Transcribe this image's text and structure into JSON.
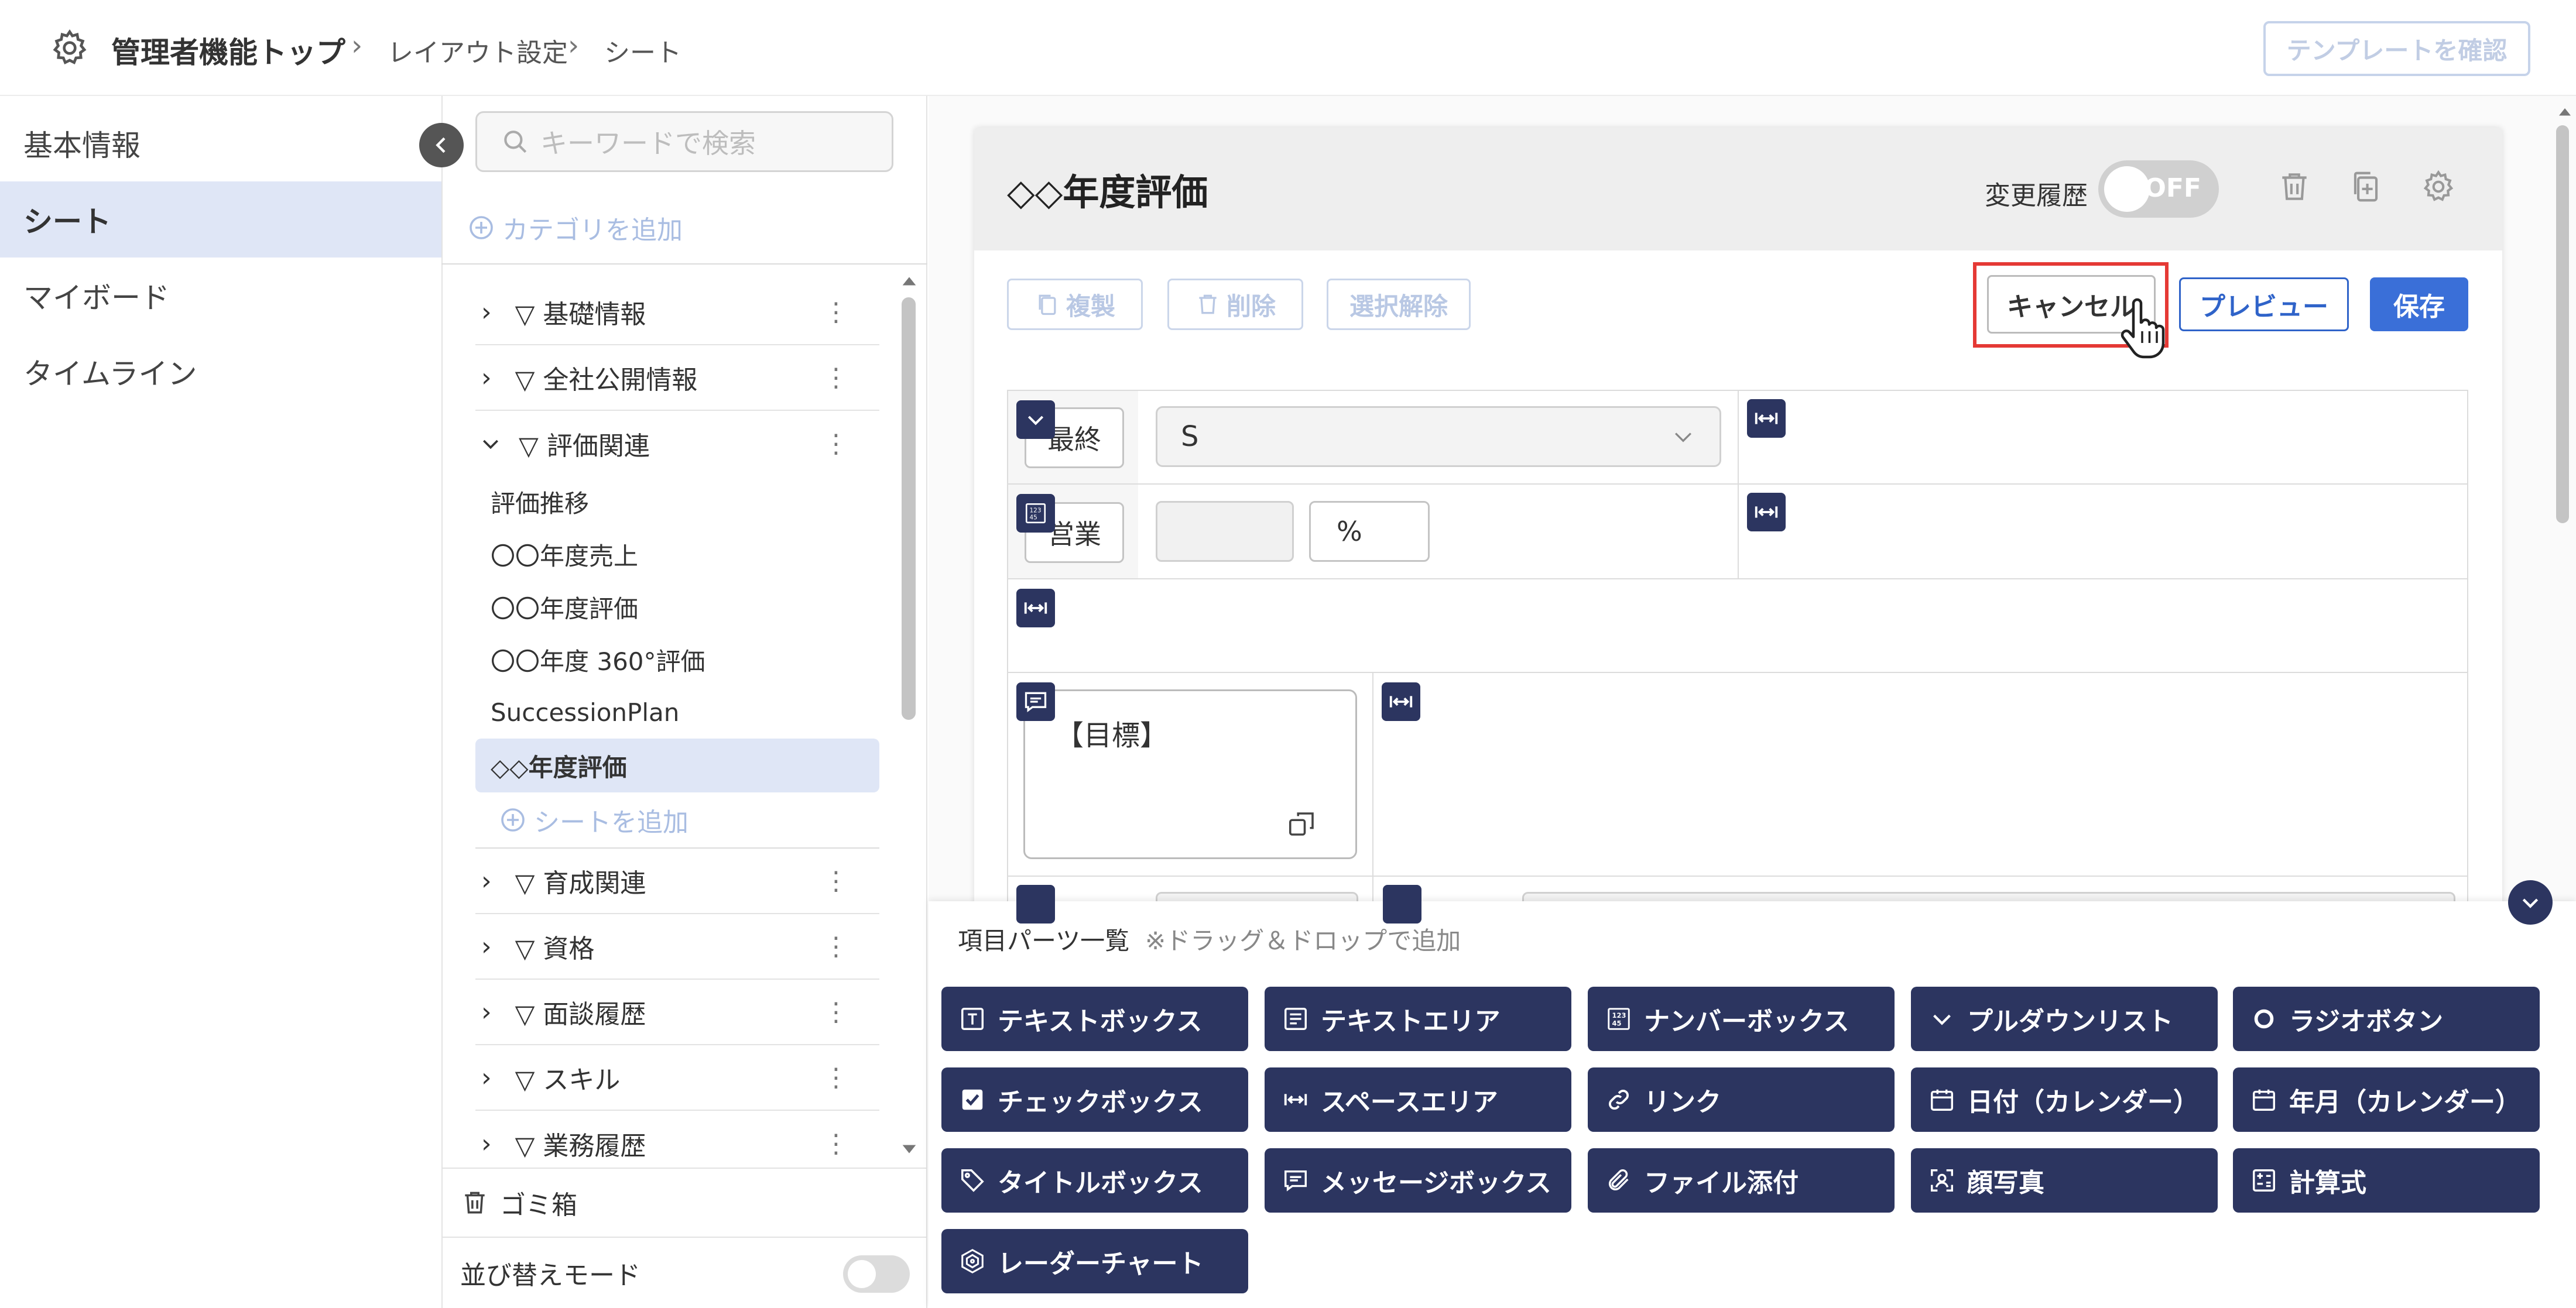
{
  "header": {
    "top_label": "管理者機能トップ",
    "crumb1": "レイアウト設定",
    "crumb2": "シート",
    "template_button": "テンプレートを確認"
  },
  "left_nav": {
    "items": [
      {
        "label": "基本情報"
      },
      {
        "label": "シート"
      },
      {
        "label": "マイボード"
      },
      {
        "label": "タイムライン"
      }
    ]
  },
  "middle": {
    "search_placeholder": "キーワードで検索",
    "add_category": "カテゴリを追加",
    "categories_top": [
      {
        "label": "▽ 基礎情報"
      },
      {
        "label": "▽ 全社公開情報"
      },
      {
        "label": "▽ 評価関連"
      }
    ],
    "sheets": [
      "評価推移",
      "〇〇年度売上",
      "〇〇年度評価",
      "〇〇年度 360°評価",
      "SuccessionPlan",
      "◇◇年度評価"
    ],
    "add_sheet": "シートを追加",
    "categories_bottom": [
      {
        "label": "▽ 育成関連"
      },
      {
        "label": "▽ 資格"
      },
      {
        "label": "▽ 面談履歴"
      },
      {
        "label": "▽ スキル"
      },
      {
        "label": "▽ 業務履歴"
      }
    ],
    "trash": "ゴミ箱",
    "sort_mode": "並び替えモード"
  },
  "editor": {
    "title": "◇◇年度評価",
    "history_label": "変更履歴",
    "history_toggle": "OFF",
    "toolbar": {
      "copy": "複製",
      "delete": "削除",
      "deselect": "選択解除",
      "cancel": "キャンセル",
      "preview": "プレビュー",
      "save": "保存"
    },
    "fields": {
      "final_label": "最終",
      "final_value": "S",
      "sales_label": "営業",
      "percent": "%",
      "goal_text": "【目標】"
    }
  },
  "parts": {
    "title": "項目パーツ一覧",
    "note": "※ドラッグ＆ドロップで追加",
    "items": [
      {
        "label": "テキストボックス",
        "icon": "textbox-icon"
      },
      {
        "label": "テキストエリア",
        "icon": "textarea-icon"
      },
      {
        "label": "ナンバーボックス",
        "icon": "numberbox-icon"
      },
      {
        "label": "プルダウンリスト",
        "icon": "chevron-down-icon"
      },
      {
        "label": "ラジオボタン",
        "icon": "radio-icon"
      },
      {
        "label": "チェックボックス",
        "icon": "checkbox-icon"
      },
      {
        "label": "スペースエリア",
        "icon": "space-icon"
      },
      {
        "label": "リンク",
        "icon": "link-icon"
      },
      {
        "label": "日付（カレンダー）",
        "icon": "calendar-icon"
      },
      {
        "label": "年月（カレンダー）",
        "icon": "calendar-icon"
      },
      {
        "label": "タイトルボックス",
        "icon": "tag-icon"
      },
      {
        "label": "メッセージボックス",
        "icon": "message-icon"
      },
      {
        "label": "ファイル添付",
        "icon": "paperclip-icon"
      },
      {
        "label": "顔写真",
        "icon": "face-icon"
      },
      {
        "label": "計算式",
        "icon": "calculator-icon"
      },
      {
        "label": "レーダーチャート",
        "icon": "radar-icon"
      }
    ]
  },
  "colors": {
    "accent": "#3a6fd8",
    "navy": "#2c3560",
    "highlight": "#e53935",
    "active_bg": "#dfe6f6"
  }
}
